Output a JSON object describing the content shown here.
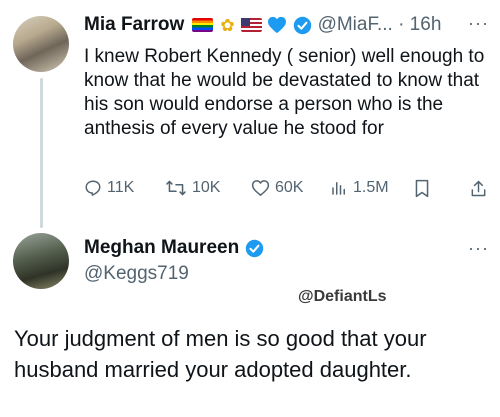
{
  "tweet1": {
    "display_name": "Mia Farrow",
    "handle_time": "@MiaF... · 16h",
    "body": "I knew Robert Kennedy ( senior) well enough to know that he would be devastated to know that his son would endorse a person who is the anthesis of every value he stood for",
    "icons": [
      "rainbow-flag-icon",
      "sunflower-icon",
      "us-flag-icon",
      "blue-heart-icon",
      "verified-badge-icon"
    ],
    "actions": {
      "replies": "11K",
      "reposts": "10K",
      "likes": "60K",
      "views": "1.5M"
    }
  },
  "tweet2": {
    "display_name": "Meghan Maureen",
    "handle": "@Keggs719",
    "watermark": "@DefiantLs",
    "body": "Your judgment of men is so good that your husband married your adopted daughter."
  },
  "colors": {
    "text": "#0f1419",
    "muted": "#536471",
    "verified": "#1d9bf0",
    "thread_line": "#cfd9de"
  }
}
